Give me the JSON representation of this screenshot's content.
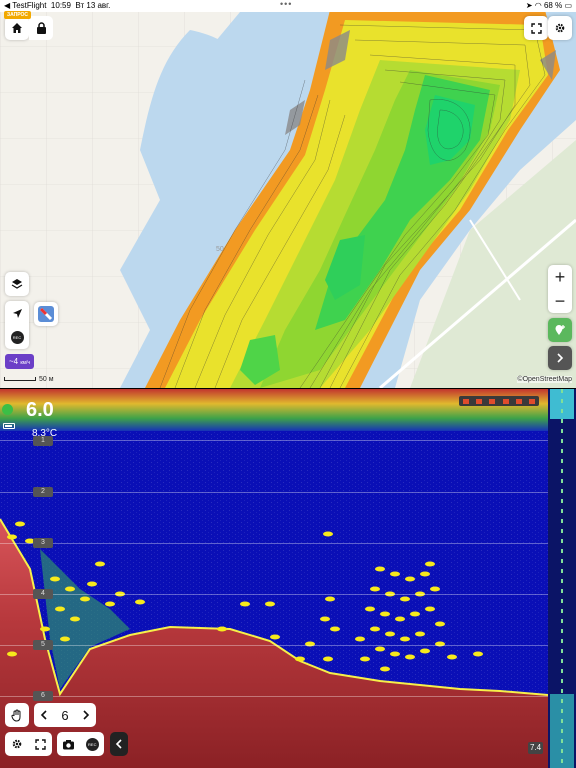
{
  "status_bar": {
    "app_label": "◀ TestFlight",
    "time": "10:59",
    "date": "Вт 13 авг.",
    "dots": "•••",
    "battery": "68 %",
    "badge": "ЗАПРОС"
  },
  "map": {
    "contour_label": "50",
    "scale": "50 м",
    "attribution": "©OpenStreetMap",
    "speed_value": "~4",
    "speed_unit": "км/ч",
    "zoom_in": "+",
    "zoom_out": "−",
    "rec_label": "REC",
    "colors": {
      "water": "#bcd8ee",
      "land": "#f3f1eb",
      "deep": "#1fd36b",
      "mid": "#8fd631",
      "shallow": "#e9e22c",
      "edge": "#f29a22"
    }
  },
  "sonar": {
    "depth": "6.0",
    "temperature": "8.3°C",
    "depth_scale": [
      "1",
      "2",
      "3",
      "4",
      "5",
      "6"
    ],
    "zoom_level": "7.4",
    "colors": {
      "water_column": "#0a0fb6",
      "bottom": "#c8474d",
      "bottom_line": "#f6f04a",
      "fish": "#f7ea1c"
    },
    "controls": {
      "gain_value": "6",
      "rec_label": "REC"
    }
  }
}
